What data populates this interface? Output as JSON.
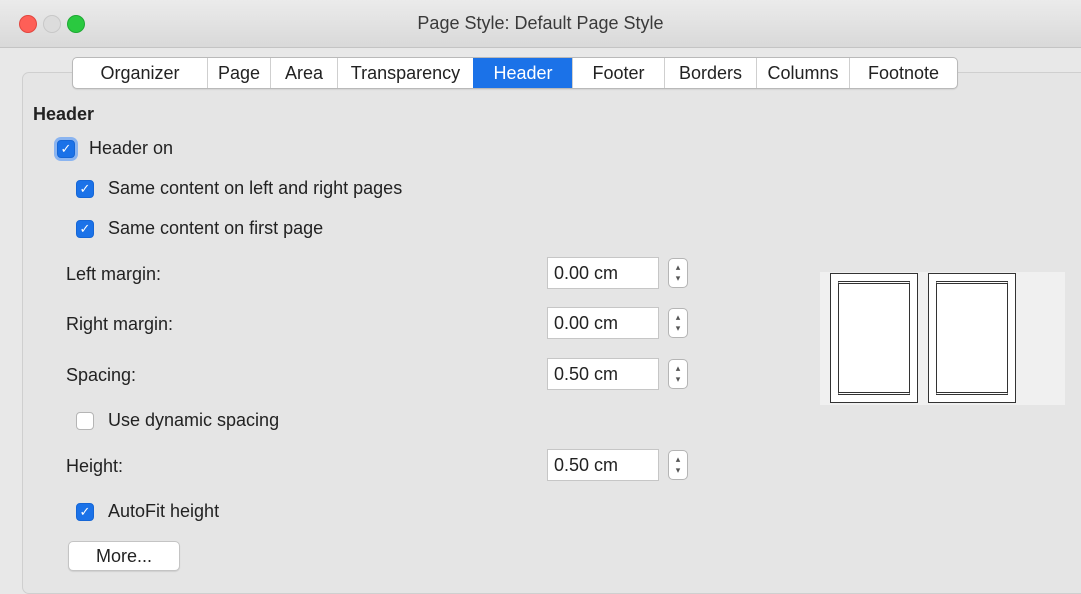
{
  "window": {
    "title": "Page Style: Default Page Style"
  },
  "tabs": [
    {
      "label": "Organizer",
      "active": false
    },
    {
      "label": "Page",
      "active": false
    },
    {
      "label": "Area",
      "active": false
    },
    {
      "label": "Transparency",
      "active": false
    },
    {
      "label": "Header",
      "active": true
    },
    {
      "label": "Footer",
      "active": false
    },
    {
      "label": "Borders",
      "active": false
    },
    {
      "label": "Columns",
      "active": false
    },
    {
      "label": "Footnote",
      "active": false
    }
  ],
  "header_section": {
    "heading": "Header",
    "header_on": {
      "label": "Header on",
      "checked": true
    },
    "same_left_right": {
      "label": "Same content on left and right pages",
      "checked": true
    },
    "same_first": {
      "label": "Same content on first page",
      "checked": true
    },
    "left_margin": {
      "label": "Left margin:",
      "value": "0.00 cm"
    },
    "right_margin": {
      "label": "Right margin:",
      "value": "0.00 cm"
    },
    "spacing": {
      "label": "Spacing:",
      "value": "0.50 cm"
    },
    "dynamic_spacing": {
      "label": "Use dynamic spacing",
      "checked": false
    },
    "height": {
      "label": "Height:",
      "value": "0.50 cm"
    },
    "autofit": {
      "label": "AutoFit height",
      "checked": true
    },
    "more_button": "More..."
  },
  "icons": {
    "checkmark": "✓",
    "spin_up": "▴",
    "spin_down": "▾"
  },
  "colors": {
    "accent": "#1b72e8",
    "close": "#fe5f57",
    "minimize": "#dcdcdc",
    "maximize": "#2ac940"
  }
}
